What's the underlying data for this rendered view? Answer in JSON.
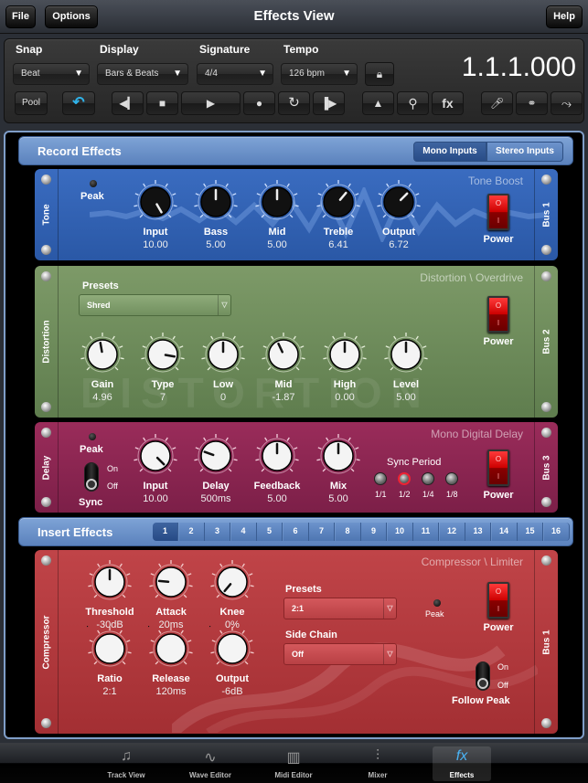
{
  "titlebar": {
    "file_label": "File",
    "options_label": "Options",
    "title": "Effects View",
    "help_label": "Help"
  },
  "toolbar": {
    "snap": {
      "label": "Snap",
      "value": "Beat"
    },
    "display": {
      "label": "Display",
      "value": "Bars & Beats"
    },
    "signature": {
      "label": "Signature",
      "value": "4/4"
    },
    "tempo": {
      "label": "Tempo",
      "value": "126 bpm"
    },
    "counter": "1.1.1.000",
    "pool_label": "Pool",
    "fx_label": "fx",
    "icons": [
      "lock-icon",
      "undo-icon",
      "rewind-icon",
      "stop-icon",
      "play-icon",
      "record-icon",
      "loop-icon",
      "fast-forward-icon",
      "metronome-icon",
      "zoom-icon",
      "fx-icon",
      "microphone-icon",
      "binoculars-icon",
      "merge-icon"
    ],
    "undo_color": "#2fb3ea"
  },
  "record_effects": {
    "title": "Record Effects",
    "mono_label": "Mono Inputs",
    "stereo_label": "Stereo Inputs",
    "selected": "Mono Inputs"
  },
  "tone": {
    "side_label": "Tone",
    "name": "Tone Boost",
    "bus": "Bus 1",
    "peak_label": "Peak",
    "power_label": "Power",
    "color": "#2f5fb0",
    "knobs": [
      {
        "label": "Input",
        "value": "10.00"
      },
      {
        "label": "Bass",
        "value": "5.00"
      },
      {
        "label": "Mid",
        "value": "5.00"
      },
      {
        "label": "Treble",
        "value": "6.41"
      },
      {
        "label": "Output",
        "value": "6.72"
      }
    ]
  },
  "distortion": {
    "side_label": "Distortion",
    "name": "Distortion \\ Overdrive",
    "bus": "Bus 2",
    "presets_label": "Presets",
    "preset_value": "Shred",
    "power_label": "Power",
    "watermark": "DISTORTION",
    "color": "#6c8a5a",
    "knobs": [
      {
        "label": "Gain",
        "value": "4.96"
      },
      {
        "label": "Type",
        "value": "7"
      },
      {
        "label": "Low",
        "value": "0"
      },
      {
        "label": "Mid",
        "value": "-1.87"
      },
      {
        "label": "High",
        "value": "0.00"
      },
      {
        "label": "Level",
        "value": "5.00"
      }
    ]
  },
  "delay": {
    "side_label": "Delay",
    "name": "Mono Digital Delay",
    "bus": "Bus 3",
    "peak_label": "Peak",
    "sync_label": "Sync",
    "on_label": "On",
    "off_label": "Off",
    "sync_period_label": "Sync Period",
    "sync_periods": [
      "1/1",
      "1/2",
      "1/4",
      "1/8"
    ],
    "sync_selected": "1/2",
    "power_label": "Power",
    "color": "#8c2450",
    "knobs": [
      {
        "label": "Input",
        "value": "10.00"
      },
      {
        "label": "Delay",
        "value": "500ms"
      },
      {
        "label": "Feedback",
        "value": "5.00"
      },
      {
        "label": "Mix",
        "value": "5.00"
      }
    ]
  },
  "insert_effects": {
    "title": "Insert Effects",
    "slots": [
      "1",
      "2",
      "3",
      "4",
      "5",
      "6",
      "7",
      "8",
      "9",
      "10",
      "11",
      "12",
      "13",
      "14",
      "15",
      "16"
    ],
    "selected": "1"
  },
  "compressor": {
    "side_label": "Compressor",
    "name": "Compressor \\ Limiter",
    "bus": "Bus 1",
    "presets_label": "Presets",
    "preset_value": "2:1",
    "side_chain_label": "Side Chain",
    "side_chain_value": "Off",
    "peak_label": "Peak",
    "power_label": "Power",
    "follow_peak_label": "Follow Peak",
    "on_label": "On",
    "off_label": "Off",
    "color": "#b5393c",
    "knobs": [
      {
        "label": "Threshold",
        "value": "-30dB"
      },
      {
        "label": "Attack",
        "value": "20ms"
      },
      {
        "label": "Knee",
        "value": "0%"
      },
      {
        "label": "Ratio",
        "value": "2:1"
      },
      {
        "label": "Release",
        "value": "120ms"
      },
      {
        "label": "Output",
        "value": "-6dB"
      }
    ]
  },
  "tabbar": {
    "tabs": [
      {
        "label": "Track View",
        "icon": "♫"
      },
      {
        "label": "Wave Editor",
        "icon": "∿"
      },
      {
        "label": "Midi Editor",
        "icon": "▥"
      },
      {
        "label": "Mixer",
        "icon": "⫶"
      },
      {
        "label": "Effects",
        "icon": "fx"
      }
    ],
    "active": "Effects"
  }
}
